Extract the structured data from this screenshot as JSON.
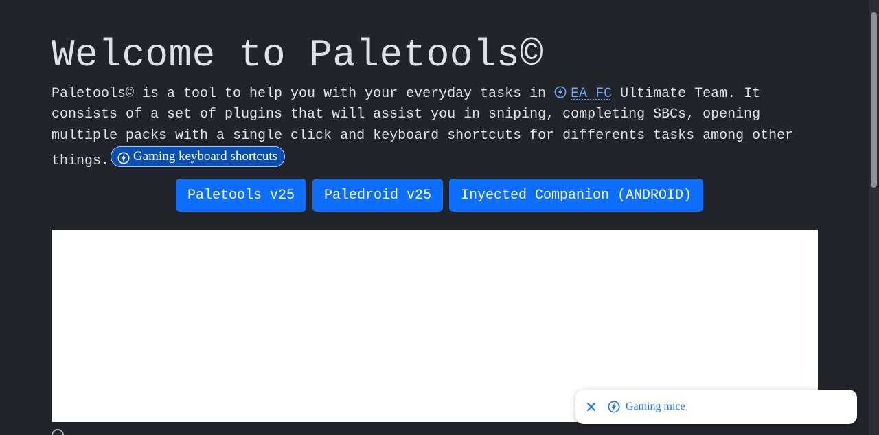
{
  "page": {
    "title": "Welcome to Paletools©",
    "intro_before": "Paletools© is a tool to help you with your everyday tasks in",
    "ea_link": "EA FC",
    "intro_after": " Ultimate Team. It consists of a set of plugins that will assist you in sniping, completing SBCs, opening multiple packs with a single click and keyboard shortcuts for differents tasks among other things.",
    "chip_label": "Gaming keyboard shortcuts"
  },
  "buttons": [
    {
      "label": "Paletools v25"
    },
    {
      "label": "Paledroid v25"
    },
    {
      "label": "Inyected Companion (ANDROID)"
    }
  ],
  "toast": {
    "label": "Gaming mice"
  },
  "icons": {
    "bolt": "bolt-circle-icon",
    "close": "close-icon"
  },
  "colors": {
    "background": "#212529",
    "text": "#dee2e6",
    "link": "#6ea8fe",
    "button": "#0d6efd",
    "chip": "#0b4fb3",
    "toast_link": "#1a73e8"
  }
}
